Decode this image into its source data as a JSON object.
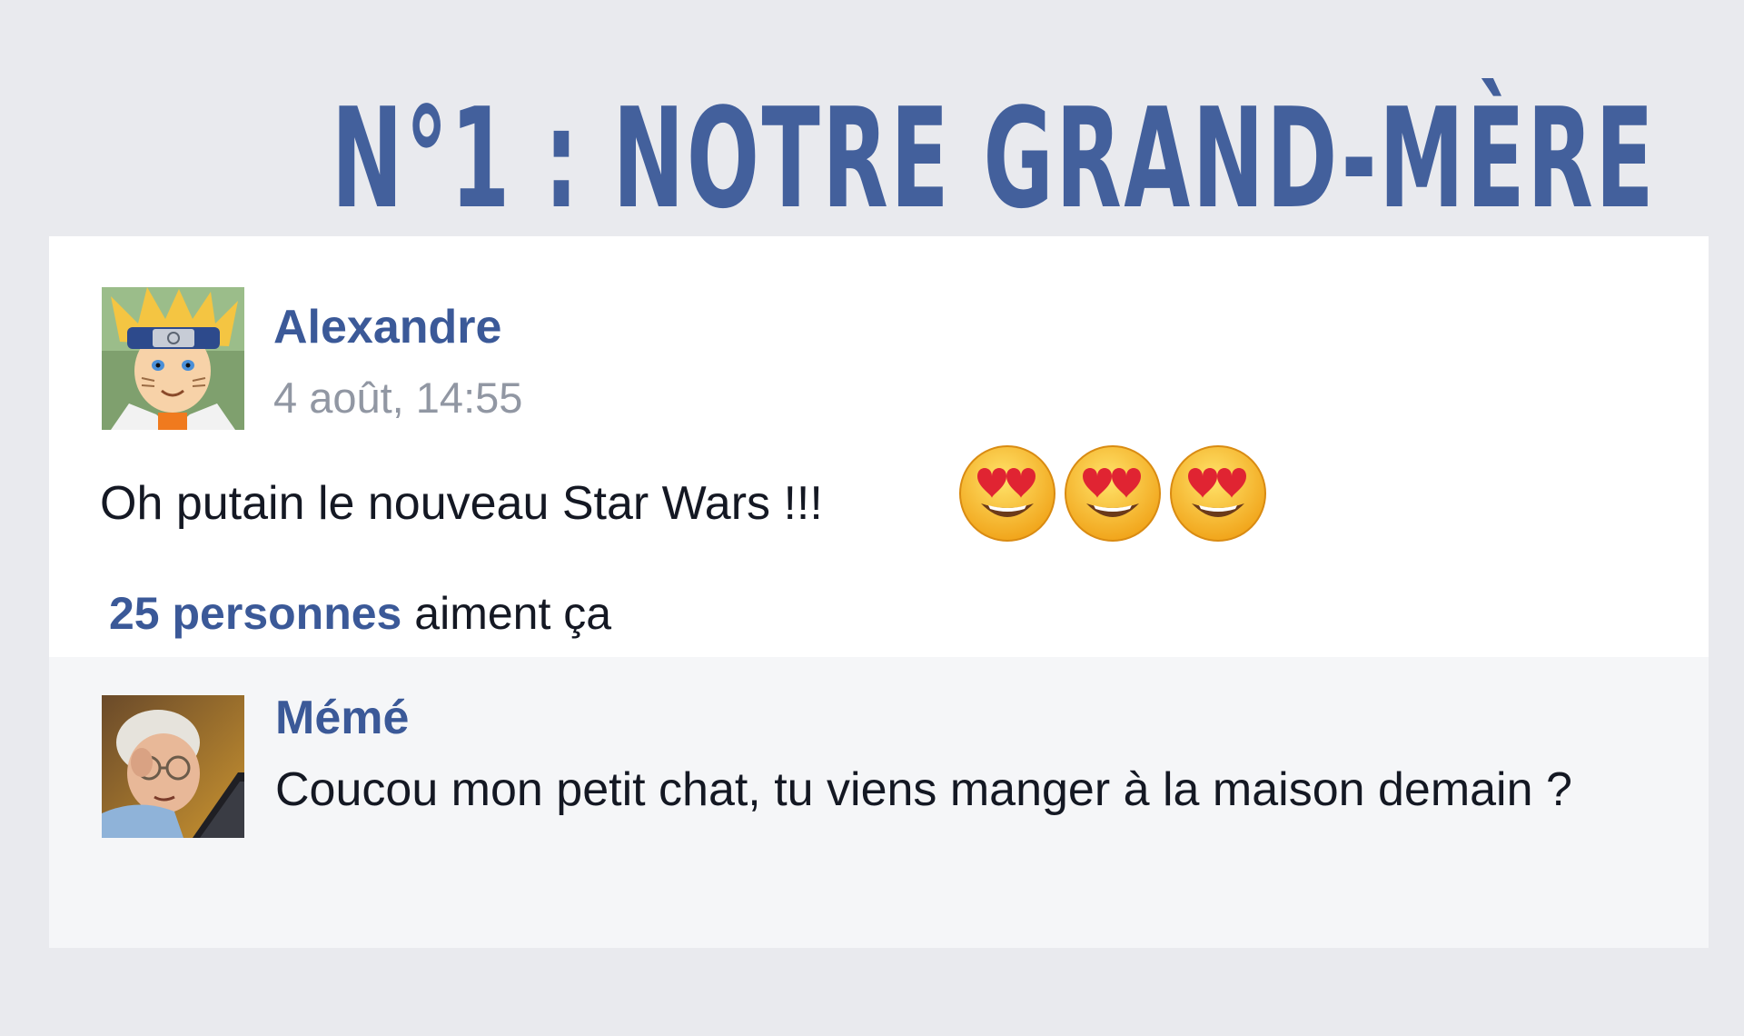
{
  "headline": "N°1 : NOTRE GRAND-MÈRE",
  "post": {
    "author": "Alexandre",
    "timestamp": "4 août, 14:55",
    "text": "Oh putain le nouveau Star Wars !!!",
    "emojis": [
      "heart-eyes-emoji",
      "heart-eyes-emoji",
      "heart-eyes-emoji"
    ],
    "likes": {
      "count_text": "25 personnes",
      "suffix": "aiment ça"
    }
  },
  "comment": {
    "author": "Mémé",
    "text": "Coucou mon petit chat, tu viens manger à la maison demain ?"
  },
  "colors": {
    "brand_blue": "#3b5998",
    "headline_blue": "#43609c",
    "background": "#e9eaee",
    "card": "#ffffff",
    "comment_area": "#f5f6f8",
    "muted_text": "#9197a3"
  }
}
